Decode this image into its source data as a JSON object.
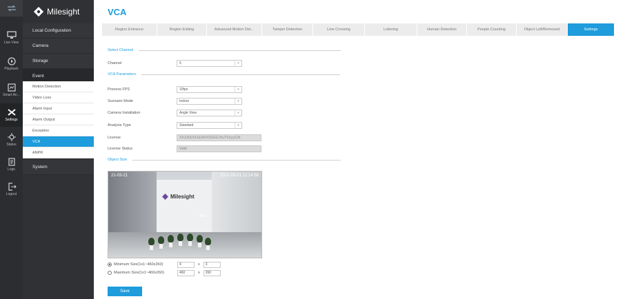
{
  "brand": {
    "name": "Milesight"
  },
  "rail": {
    "items": [
      {
        "label": "Live View",
        "icon": "monitor-icon"
      },
      {
        "label": "Playback",
        "icon": "playback-icon"
      },
      {
        "label": "Smart An...",
        "icon": "smart-analysis-icon"
      },
      {
        "label": "Settings",
        "icon": "settings-icon"
      },
      {
        "label": "Status",
        "icon": "status-icon"
      },
      {
        "label": "Logs",
        "icon": "logs-icon"
      },
      {
        "label": "Logout",
        "icon": "logout-icon"
      }
    ]
  },
  "sidebar": {
    "groups": [
      {
        "label": "Local Configuration"
      },
      {
        "label": "Camera"
      },
      {
        "label": "Storage"
      },
      {
        "label": "Event"
      }
    ],
    "event_items": [
      {
        "label": "Motion Detection"
      },
      {
        "label": "Video Loss"
      },
      {
        "label": "Alarm Input"
      },
      {
        "label": "Alarm Output"
      },
      {
        "label": "Exception"
      },
      {
        "label": "VCA"
      },
      {
        "label": "ANPR"
      }
    ],
    "system_label": "System"
  },
  "page": {
    "title": "VCA",
    "tabs": [
      {
        "label": "Region Entrance"
      },
      {
        "label": "Region Exiting"
      },
      {
        "label": "Advanced Motion Det..."
      },
      {
        "label": "Tamper Detection"
      },
      {
        "label": "Line Crossing"
      },
      {
        "label": "Loitering"
      },
      {
        "label": "Human Detection"
      },
      {
        "label": "People Counting"
      },
      {
        "label": "Object Left/Removed"
      },
      {
        "label": "Settings"
      }
    ],
    "select_channel_section": "Select Channel",
    "channel_label": "Channel",
    "channel_value": "5",
    "vca_params_section": "VCA Parameters",
    "params": {
      "process_fps_label": "Process FPS",
      "process_fps_value": "10fps",
      "scenario_label": "Scenario Mode",
      "scenario_value": "Indoor",
      "installation_label": "Camera Installation",
      "installation_value": "Angle View",
      "analysis_label": "Analysis Type",
      "analysis_value": "Standard",
      "license_label": "License",
      "license_value": "XXJu5SXXZaUlXXSSGGJSuTSXyySJb",
      "license_status_label": "License Status",
      "license_status_value": "Valid"
    },
    "object_size_section": "Object Size",
    "preview": {
      "osd_left": "21-03-21",
      "osd_right": "2021-03-21 12:14:58",
      "brand_text": "Milesight",
      "mark_text": "Mis"
    },
    "min_size": {
      "label": "Minimum Size(1x1~460x260)",
      "w": "4",
      "h": "3"
    },
    "max_size": {
      "label": "Maximum Size(1x1~460x260)",
      "w": "460",
      "h": "260"
    },
    "times": "x",
    "save_label": "Save"
  },
  "colors": {
    "accent": "#1e9cdc",
    "sidebar_dark": "#2f3134",
    "rail": "#2b2d30"
  }
}
